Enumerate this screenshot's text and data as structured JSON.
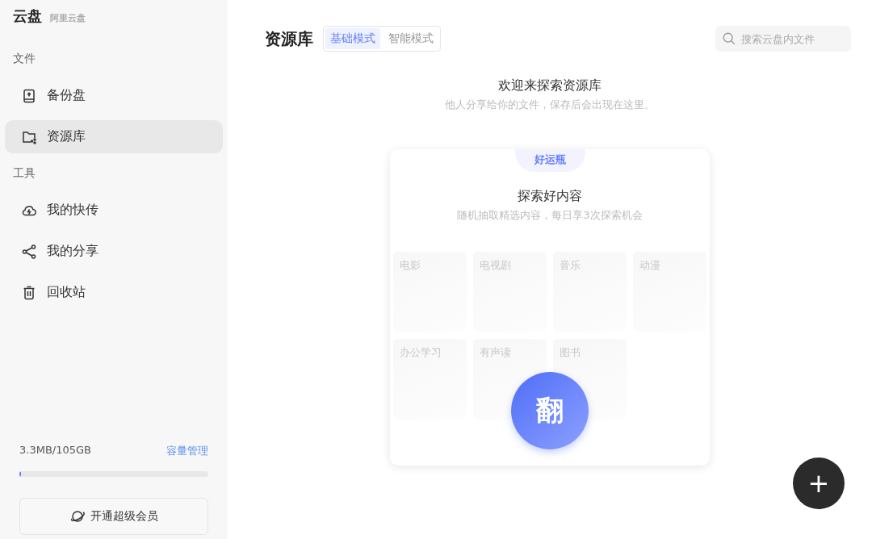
{
  "brand": {
    "name": "云盘",
    "sub": "阿里云盘"
  },
  "sidebar": {
    "sections": [
      {
        "title": "文件",
        "items": [
          {
            "label": "备份盘",
            "kind": "drive",
            "selected": false
          },
          {
            "label": "资源库",
            "kind": "folder",
            "selected": true
          }
        ]
      },
      {
        "title": "工具",
        "items": [
          {
            "label": "我的快传",
            "kind": "cloud",
            "selected": false
          },
          {
            "label": "我的分享",
            "kind": "share",
            "selected": false
          },
          {
            "label": "回收站",
            "kind": "trash",
            "selected": false
          }
        ]
      }
    ]
  },
  "storage": {
    "usage": "3.3MB/105GB",
    "manage_link": "容量管理",
    "level": 0.01
  },
  "vip_button": "开通超级会员",
  "header": {
    "title": "资源库",
    "modes": [
      {
        "label": "基础模式",
        "selected": true
      },
      {
        "label": "智能模式",
        "selected": false
      }
    ],
    "search": {
      "placeholder": "搜索云盘内文件"
    }
  },
  "welcome": {
    "title": "欢迎来探索资源库",
    "subtitle": "他人分享给你的文件，保存后会出现在这里。"
  },
  "card": {
    "badge": "好运瓶",
    "title": "探索好内容",
    "subtitle": "随机抽取精选内容，每日享3次探索机会",
    "tiles": [
      {
        "label": "电影"
      },
      {
        "label": "电视剧"
      },
      {
        "label": "音乐"
      },
      {
        "label": "动漫"
      },
      {
        "label": "办公学习"
      },
      {
        "label": "有声读"
      },
      {
        "label": "图书"
      }
    ],
    "flip_button": "翻"
  },
  "fab": "+"
}
